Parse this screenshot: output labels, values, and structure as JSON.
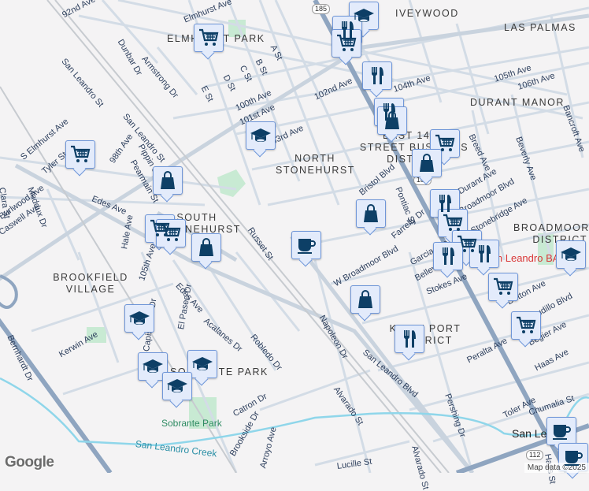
{
  "map": {
    "neighborhoods": [
      "ELMHURST PARK",
      "IVEYWOOD",
      "LAS PALMAS",
      "DURANT MANOR",
      "EAST 14TH STREET BUSINESS DISTRICT",
      "NORTH STONEHURST",
      "SOUTH STONEHURST",
      "BROADMOOR DISTRICT",
      "BROOKFIELD VILLAGE",
      "KELLY PORT DISTRICT",
      "SOBRANTE PARK"
    ],
    "streets": [
      "92nd Ave",
      "Elmhurst Ave",
      "Dunbar Dr",
      "Armstrong Dr",
      "A St",
      "B St",
      "C St",
      "D St",
      "E St",
      "San Leandro St",
      "100th Ave",
      "101st Ave",
      "103rd Ave",
      "102nd Ave",
      "104th Ave",
      "105th Ave",
      "106th Ave",
      "Breed Ave",
      "Beverly Ave",
      "Bancroft Ave",
      "S Elmhurst Ave",
      "Tyler St",
      "98th Ave",
      "Pippin St",
      "Pearmain St",
      "Edes Ave",
      "Maddux Dr",
      "Caswell Ave",
      "Burlwood Ave",
      "Clara St",
      "Hale Ave",
      "Russet St",
      "Bristol Blvd",
      "Pontiac St",
      "Farrelly Dr",
      "Durant Ave",
      "Broadmoor Blvd",
      "Stonebridge Ave",
      "W Broadmoor Blvd",
      "Garcia Ave",
      "Bellevue Ave",
      "Stokes Ave",
      "Dutton Ave",
      "Estudillo Blvd",
      "Begier Ave",
      "Peralta Ave",
      "Haas Ave",
      "Napoleon Dr",
      "San Leandro Blvd",
      "Pershing Dr",
      "Toler Ave",
      "Chumalia St",
      "Alvarado St",
      "Lucille St",
      "Bernhardt Dr",
      "Kerwin Ave",
      "Capistrano Dr",
      "El Paseo Dr",
      "Acalanes Dr",
      "Robledo Dr",
      "Catron Dr",
      "Brookside Dr",
      "105th Ave",
      "Edes Ave",
      "Arroyo Ave",
      "Alvarado St",
      "Hays St"
    ],
    "parks": [
      "Sobrante Park"
    ],
    "waterways": [
      "San Leandro Creek"
    ],
    "poi": [
      "San Leandro BART"
    ],
    "city": "San Leandro",
    "route_shields": [
      "185",
      "185",
      "112"
    ],
    "logo": "Google",
    "attribution": "Map data ©2025"
  },
  "markers": [
    {
      "type": "school-icon"
    },
    {
      "type": "restaurant-icon"
    },
    {
      "type": "grocery-icon"
    },
    {
      "type": "restaurant-icon"
    },
    {
      "type": "restaurant-icon"
    },
    {
      "type": "shopping-icon"
    },
    {
      "type": "grocery-icon"
    },
    {
      "type": "shopping-icon"
    },
    {
      "type": "shopping-icon"
    },
    {
      "type": "restaurant-icon"
    },
    {
      "type": "grocery-icon"
    },
    {
      "type": "grocery-icon"
    },
    {
      "type": "coffee-icon"
    },
    {
      "type": "restaurant-icon"
    },
    {
      "type": "restaurant-icon"
    },
    {
      "type": "school-icon"
    },
    {
      "type": "grocery-icon"
    },
    {
      "type": "shopping-icon"
    },
    {
      "type": "restaurant-icon"
    },
    {
      "type": "grocery-icon"
    },
    {
      "type": "coffee-icon"
    },
    {
      "type": "coffee-icon"
    },
    {
      "type": "grocery-icon"
    },
    {
      "type": "school-icon"
    },
    {
      "type": "grocery-icon"
    },
    {
      "type": "shopping-icon"
    },
    {
      "type": "grocery-icon"
    },
    {
      "type": "grocery-icon"
    },
    {
      "type": "shopping-icon"
    },
    {
      "type": "school-icon"
    },
    {
      "type": "school-icon"
    },
    {
      "type": "school-icon"
    },
    {
      "type": "school-icon"
    }
  ],
  "colors": {
    "background": "#f4f3f4",
    "road": "#d3dce6",
    "highway": "#8fa5c0",
    "park": "#c8ead3",
    "water": "#8fd6ea",
    "marker_fill": "#e3ebfb",
    "marker_border": "#6f96d8",
    "icon": "#0d3f66"
  }
}
